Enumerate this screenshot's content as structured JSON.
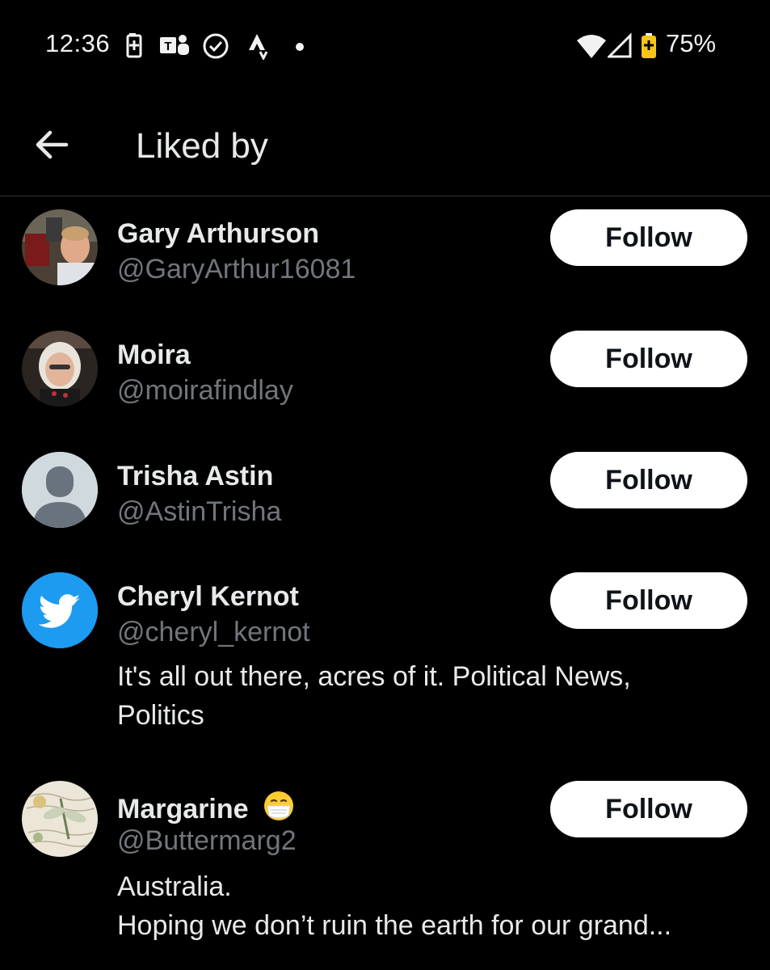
{
  "status_bar": {
    "time": "12:36",
    "battery_percent": "75%"
  },
  "header": {
    "title": "Liked by"
  },
  "users": [
    {
      "name": "Gary Arthurson",
      "handle": "@GaryArthur16081",
      "follow_label": "Follow"
    },
    {
      "name": "Moira",
      "handle": "@moirafindlay",
      "follow_label": "Follow"
    },
    {
      "name": "Trisha Astin",
      "handle": "@AstinTrisha",
      "follow_label": "Follow"
    },
    {
      "name": "Cheryl Kernot",
      "handle": "@cheryl_kernot",
      "follow_label": "Follow",
      "bio": [
        "It's all out there, acres of it. Political News,",
        "Politics"
      ]
    },
    {
      "name": "Margarine",
      "handle": "@Buttermarg2",
      "follow_label": "Follow",
      "bio": [
        "Australia.",
        "Hoping we don’t ruin the earth for our grand..."
      ]
    }
  ],
  "colors": {
    "background": "#000000",
    "text_primary": "#e7e9ea",
    "text_secondary": "#71767b",
    "button_bg": "#ffffff",
    "twitter_blue": "#1d9bf0"
  }
}
